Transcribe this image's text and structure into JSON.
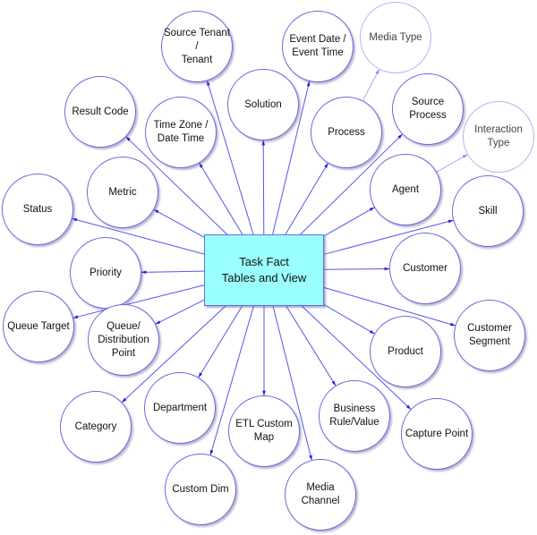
{
  "diagram": {
    "title": "Task Fact Tables and View",
    "center": {
      "label": "Task Fact\nTables and View",
      "fill": "#99ffff"
    },
    "colors": {
      "line": "#5555ee",
      "light_line": "#a8a8f0",
      "node_border": "#6b6bdc"
    },
    "nodes": [
      {
        "id": "source-tenant",
        "label": "Source Tenant /\nTenant",
        "from": "center"
      },
      {
        "id": "event-date",
        "label": "Event Date /\nEvent Time",
        "from": "center"
      },
      {
        "id": "media-type",
        "label": "Media Type",
        "from": "process",
        "style": "light"
      },
      {
        "id": "result-code",
        "label": "Result Code",
        "from": "center"
      },
      {
        "id": "time-zone",
        "label": "Time Zone /\nDate Time",
        "from": "center"
      },
      {
        "id": "solution",
        "label": "Solution",
        "from": "center"
      },
      {
        "id": "process",
        "label": "Process",
        "from": "center"
      },
      {
        "id": "source-process",
        "label": "Source\nProcess",
        "from": "center"
      },
      {
        "id": "interaction-type",
        "label": "Interaction\nType",
        "from": "agent",
        "style": "light"
      },
      {
        "id": "metric",
        "label": "Metric",
        "from": "center"
      },
      {
        "id": "agent",
        "label": "Agent",
        "from": "center"
      },
      {
        "id": "status",
        "label": "Status",
        "from": "center"
      },
      {
        "id": "skill",
        "label": "Skill",
        "from": "center"
      },
      {
        "id": "priority",
        "label": "Priority",
        "from": "center"
      },
      {
        "id": "customer",
        "label": "Customer",
        "from": "center"
      },
      {
        "id": "queue-target",
        "label": "Queue Target",
        "from": "center"
      },
      {
        "id": "queue-distribution-point",
        "label": "Queue/\nDistribution\nPoint",
        "from": "center"
      },
      {
        "id": "customer-segment",
        "label": "Customer\nSegment",
        "from": "center"
      },
      {
        "id": "product",
        "label": "Product",
        "from": "center"
      },
      {
        "id": "department",
        "label": "Department",
        "from": "center"
      },
      {
        "id": "category",
        "label": "Category",
        "from": "center"
      },
      {
        "id": "etl-custom-map",
        "label": "ETL Custom\nMap",
        "from": "center"
      },
      {
        "id": "business-rule-value",
        "label": "Business\nRule/Value",
        "from": "center"
      },
      {
        "id": "capture-point",
        "label": "Capture Point",
        "from": "center"
      },
      {
        "id": "custom-dim",
        "label": "Custom Dim",
        "from": "center"
      },
      {
        "id": "media-channel",
        "label": "Media\nChannel",
        "from": "center"
      }
    ]
  }
}
